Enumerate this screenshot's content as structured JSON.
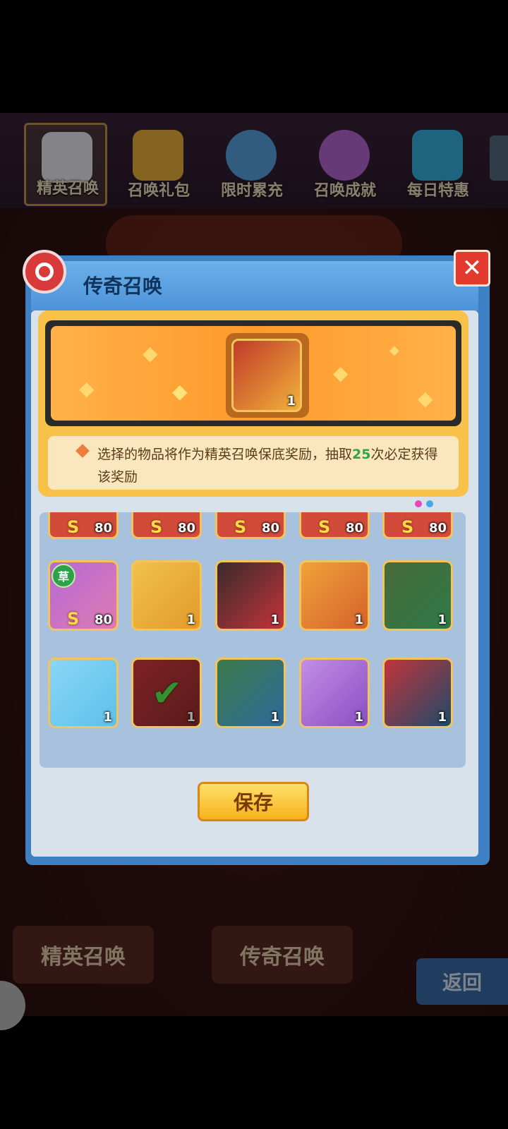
{
  "top_nav": {
    "items": [
      {
        "label": "精英召唤",
        "icon": "rabbit-icon",
        "color": "#f0f0f8",
        "active": true
      },
      {
        "label": "召唤礼包",
        "icon": "gift-box-icon",
        "color": "#f2b53c"
      },
      {
        "label": "限时累充",
        "icon": "stopwatch-icon",
        "color": "#5aa6e8"
      },
      {
        "label": "召唤成就",
        "icon": "medal-icon",
        "color": "#b86ad8"
      },
      {
        "label": "每日特惠",
        "icon": "treasure-chest-icon",
        "color": "#39b7e8"
      }
    ]
  },
  "dialog": {
    "title": "传奇召唤",
    "info_text_before": "选择的物品将作为精英召唤保底奖励，抽取",
    "info_count": "25",
    "info_text_after": "次必定获得该奖励",
    "selected_count": "1",
    "save_label": "保存"
  },
  "grid": {
    "row0": [
      {
        "s": "S",
        "count": "80",
        "color": "#d24a3a"
      },
      {
        "s": "S",
        "count": "80",
        "color": "#d24a3a"
      },
      {
        "s": "S",
        "count": "80",
        "color": "#d24a3a"
      },
      {
        "s": "S",
        "count": "80",
        "color": "#d24a3a"
      },
      {
        "s": "S",
        "count": "80",
        "color": "#d24a3a"
      }
    ],
    "row1": [
      {
        "element": "草",
        "s": "S",
        "count": "80",
        "color": "#b36ad8"
      },
      {
        "count": "1",
        "color": "#e39a2a"
      },
      {
        "count": "1",
        "color": "#c2343a"
      },
      {
        "count": "1",
        "color": "#d4622a"
      },
      {
        "count": "1",
        "color": "#2e7a48"
      }
    ],
    "row2": [
      {
        "count": "1",
        "color": "#5ec0ea"
      },
      {
        "count": "1",
        "color": "#8a2a2a",
        "selected": true
      },
      {
        "count": "1",
        "color": "#2f6a9a"
      },
      {
        "count": "1",
        "color": "#8a4ec2"
      },
      {
        "count": "1",
        "color": "#1e4a6a"
      }
    ]
  },
  "bottom": {
    "elite_label": "精英召唤",
    "legend_label": "传奇召唤",
    "back_label": "返回"
  },
  "banner_text": "传奇召唤"
}
